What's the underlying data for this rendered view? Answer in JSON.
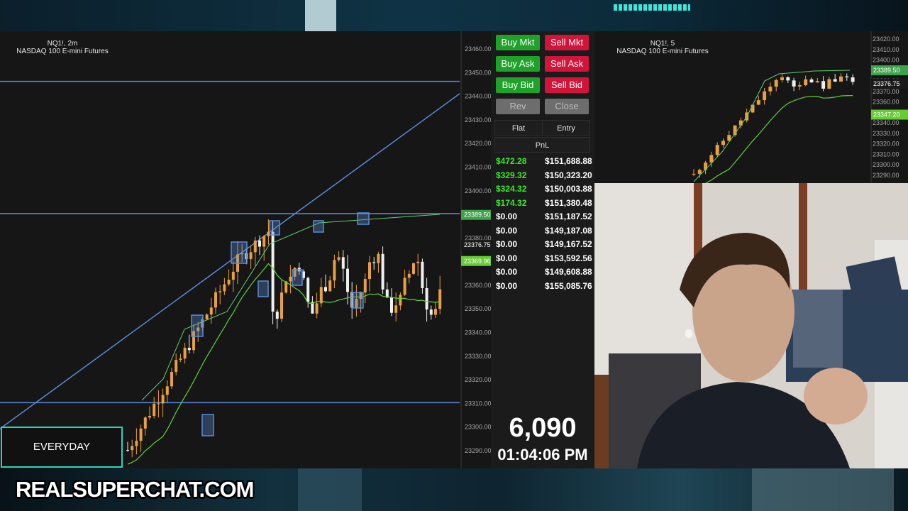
{
  "left_chart": {
    "symbol": "NQ1!, 2m",
    "name": "NASDAQ 100 E-mini Futures",
    "price_ticks": [
      "23460.00",
      "23450.00",
      "23440.00",
      "23430.00",
      "23420.00",
      "23410.00",
      "23400.00",
      "23390.00",
      "23380.00",
      "23370.00",
      "23360.00",
      "23350.00",
      "23340.00",
      "23330.00",
      "23320.00",
      "23310.00",
      "23300.00",
      "23290.00"
    ],
    "price_tags": [
      {
        "label": "23389.50",
        "value": 23389.5,
        "color": "#3fa34d"
      },
      {
        "label": "23376.75",
        "value": 23376.75,
        "color": "#1a1a1a"
      },
      {
        "label": "23369.96",
        "value": 23369.96,
        "color": "#66cc33"
      }
    ]
  },
  "order_panel": {
    "buttons": {
      "buy_mkt": "Buy Mkt",
      "sell_mkt": "Sell Mkt",
      "buy_ask": "Buy Ask",
      "sell_ask": "Sell Ask",
      "buy_bid": "Buy Bid",
      "sell_bid": "Sell Bid",
      "rev": "Rev",
      "close": "Close"
    },
    "tabs": {
      "flat": "Flat",
      "entry": "Entry",
      "pnl": "PnL"
    },
    "pnl_rows": [
      {
        "pnl": "$472.28",
        "balance": "$151,688.88",
        "positive": true
      },
      {
        "pnl": "$329.32",
        "balance": "$150,323.20",
        "positive": true
      },
      {
        "pnl": "$324.32",
        "balance": "$150,003.88",
        "positive": true
      },
      {
        "pnl": "$174.32",
        "balance": "$151,380.48",
        "positive": true
      },
      {
        "pnl": "$0.00",
        "balance": "$151,187.52",
        "positive": false
      },
      {
        "pnl": "$0.00",
        "balance": "$149,187.08",
        "positive": false
      },
      {
        "pnl": "$0.00",
        "balance": "$149,167.52",
        "positive": false
      },
      {
        "pnl": "$0.00",
        "balance": "$153,592.56",
        "positive": false
      },
      {
        "pnl": "$0.00",
        "balance": "$149,608.88",
        "positive": false
      },
      {
        "pnl": "$0.00",
        "balance": "$155,085.76",
        "positive": false
      }
    ],
    "counter": "6,090",
    "clock": "01:04:06 PM"
  },
  "right_chart": {
    "symbol": "NQ1!, 5",
    "name": "NASDAQ 100 E-mini Futures",
    "price_ticks": [
      "23420.00",
      "23410.00",
      "23400.00",
      "23390.00",
      "23380.00",
      "23370.00",
      "23360.00",
      "23350.00",
      "23340.00",
      "23330.00",
      "23320.00",
      "23310.00",
      "23300.00",
      "23290.00"
    ],
    "price_tags": [
      {
        "label": "23389.50",
        "value": 23389.5,
        "color": "#3fa34d"
      },
      {
        "label": "23376.75",
        "value": 23376.75,
        "color": "#1a1a1a"
      },
      {
        "label": "23347.20",
        "value": 23347.2,
        "color": "#66cc33"
      }
    ]
  },
  "overlay": {
    "banner": "EVERYDAY",
    "logo": "REALSUPERCHAT.COM"
  },
  "colors": {
    "candle_up": "#e8a040",
    "candle_down": "#f0f0f0",
    "trendline": "#5b8bd6",
    "ma_line": "#5fd33a",
    "box": "#5b8bd6",
    "accent": "#2fd1bd"
  }
}
